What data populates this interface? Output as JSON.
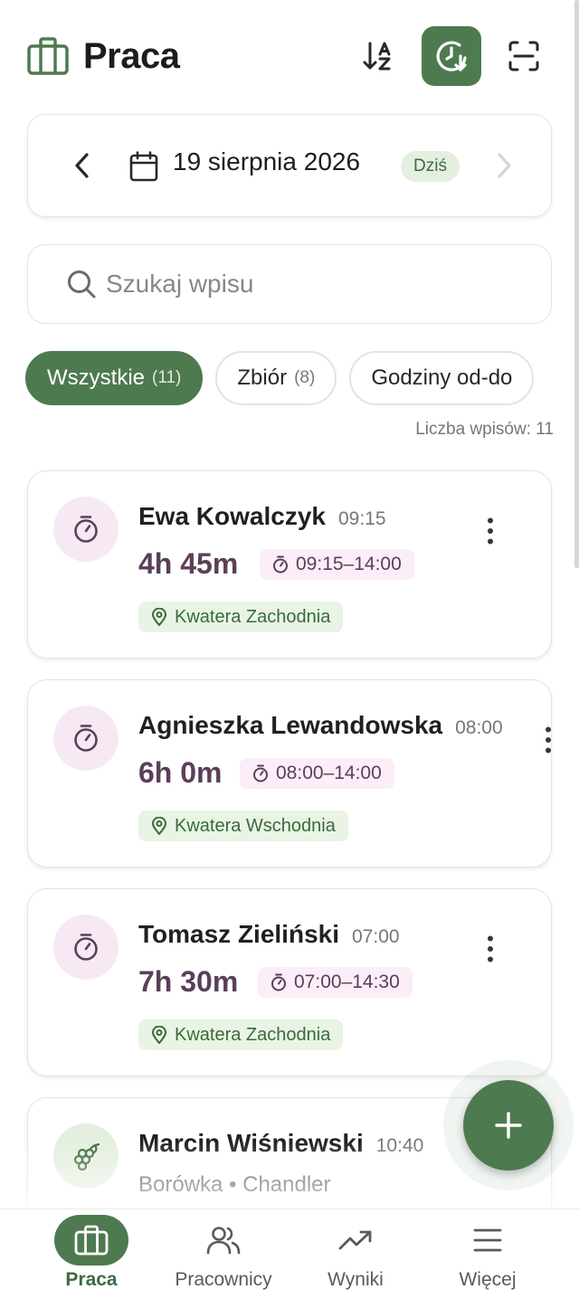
{
  "header": {
    "title": "Praca",
    "icons": [
      "briefcase-icon",
      "sort-az-icon",
      "clock-download-icon",
      "scan-icon"
    ],
    "accent_color": "#4e7a50"
  },
  "date_nav": {
    "date": "19 sierpnia 2026",
    "today_label": "Dziś"
  },
  "search": {
    "placeholder": "Szukaj wpisu",
    "value": ""
  },
  "filters": [
    {
      "label": "Wszystkie",
      "count": "(11)",
      "active": true
    },
    {
      "label": "Zbiór",
      "count": "(8)",
      "active": false
    },
    {
      "label": "Godziny od-do",
      "count": "",
      "active": false
    }
  ],
  "entries_count": "Liczba wpisów: 11",
  "entries": [
    {
      "name": "Ewa Kowalczyk",
      "time": "09:15",
      "duration": "4h 45m",
      "range": "09:15–14:00",
      "location": "Kwatera Zachodnia",
      "icon": "stopwatch-icon"
    },
    {
      "name": "Agnieszka Lewandowska",
      "time": "08:00",
      "duration": "6h 0m",
      "range": "08:00–14:00",
      "location": "Kwatera Wschodnia",
      "icon": "stopwatch-icon"
    },
    {
      "name": "Tomasz Zieliński",
      "time": "07:00",
      "duration": "7h 30m",
      "range": "07:00–14:30",
      "location": "Kwatera Zachodnia",
      "icon": "stopwatch-icon"
    },
    {
      "name": "Marcin Wiśniewski",
      "time": "10:40",
      "subtitle": "Borówka • Chandler",
      "icon": "grapes-icon"
    }
  ],
  "bottom_nav": [
    {
      "label": "Praca",
      "icon": "briefcase-icon",
      "active": true
    },
    {
      "label": "Pracownicy",
      "icon": "users-icon",
      "active": false
    },
    {
      "label": "Wyniki",
      "icon": "trending-up-icon",
      "active": false
    },
    {
      "label": "Więcej",
      "icon": "menu-icon",
      "active": false
    }
  ]
}
